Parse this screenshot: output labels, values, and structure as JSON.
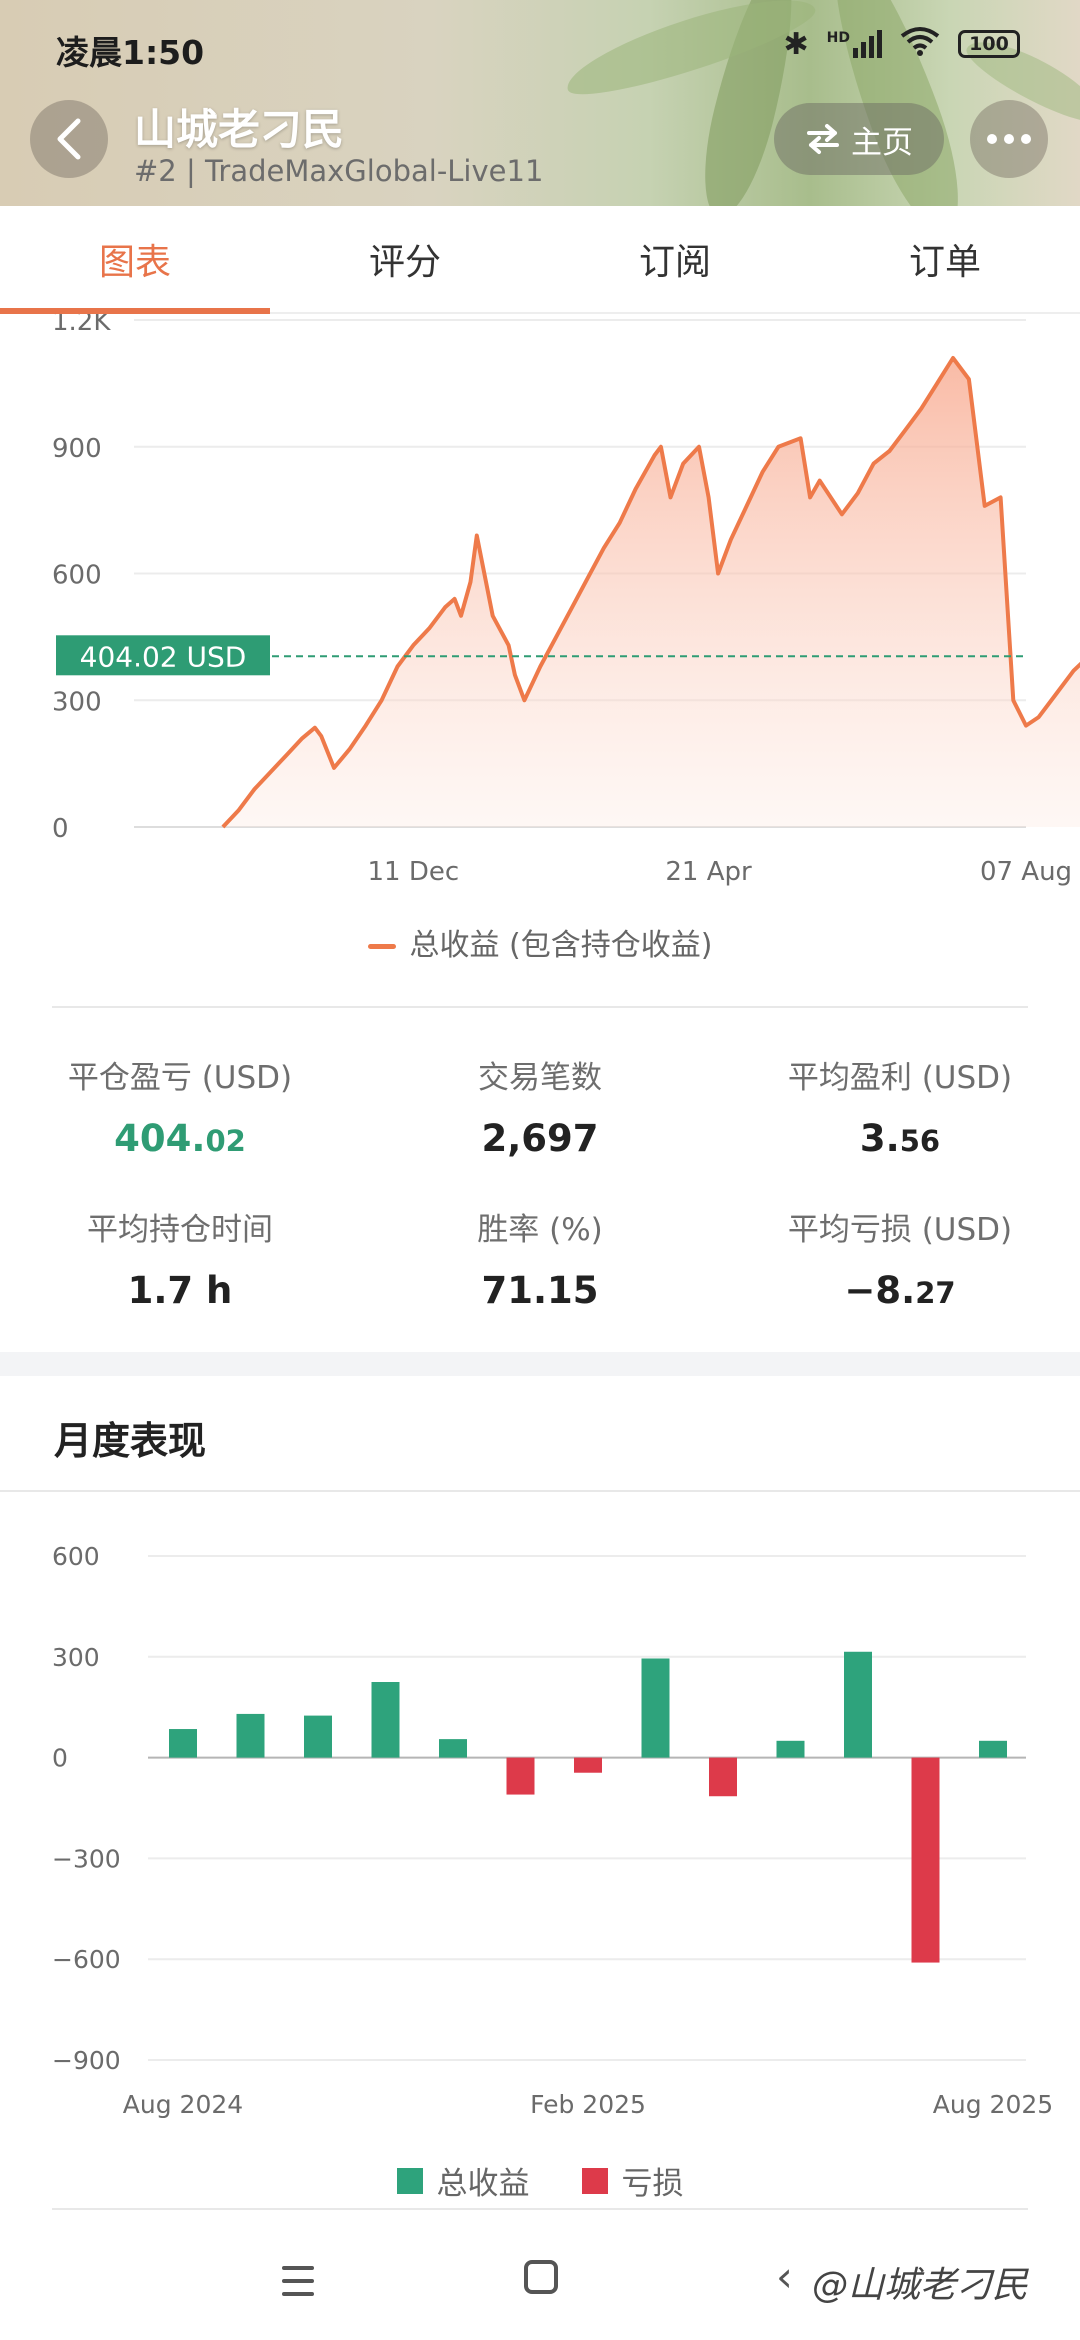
{
  "status_bar": {
    "time": "凌晨1:50",
    "signal": "HD",
    "battery": "100"
  },
  "header": {
    "title": "山城老刁民",
    "subtitle": "#2 | TradeMaxGlobal-Live11",
    "home_label": "主页"
  },
  "tabs": [
    {
      "label": "图表",
      "active": true
    },
    {
      "label": "评分",
      "active": false
    },
    {
      "label": "订阅",
      "active": false
    },
    {
      "label": "订单",
      "active": false
    }
  ],
  "line_chart": {
    "current_value_label": "404.02 USD",
    "legend": "总收益 (包含持仓收益)"
  },
  "stats": {
    "closed_pnl": {
      "label": "平仓盈亏 (USD)",
      "int": "404.",
      "dec": "02"
    },
    "trades": {
      "label": "交易笔数",
      "value": "2,697"
    },
    "avg_profit": {
      "label": "平均盈利 (USD)",
      "int": "3.",
      "dec": "56"
    },
    "avg_hold": {
      "label": "平均持仓时间",
      "value": "1.7 h"
    },
    "win_rate": {
      "label": "胜率 (%)",
      "value": "71.15"
    },
    "avg_loss": {
      "label": "平均亏损 (USD)",
      "int": "−8.",
      "dec": "27"
    }
  },
  "monthly": {
    "title": "月度表现",
    "legend_profit": "总收益",
    "legend_loss": "亏损"
  },
  "watermark": "@山城老刁民",
  "chart_data": [
    {
      "type": "area",
      "title": "",
      "xlabel": "",
      "ylabel": "",
      "ylim": [
        0,
        1200
      ],
      "yticks": [
        "0",
        "300",
        "600",
        "900",
        "1.2K"
      ],
      "xticks": [
        {
          "label": "11 Dec",
          "x": 60
        },
        {
          "label": "21 Apr",
          "x": 153
        },
        {
          "label": "07 Aug",
          "x": 253
        }
      ],
      "x_range": [
        -28,
        253
      ],
      "reference_line": 404.02,
      "color": "#ee7a4a",
      "series": [
        {
          "name": "总收益 (包含持仓收益)",
          "x": [
            0,
            5,
            10,
            15,
            20,
            25,
            29,
            31,
            35,
            40,
            45,
            50,
            55,
            60,
            65,
            70,
            73,
            75,
            78,
            80,
            85,
            90,
            92,
            95,
            100,
            105,
            110,
            115,
            120,
            125,
            130,
            136,
            138,
            141,
            145,
            150,
            153,
            156,
            160,
            165,
            170,
            175,
            182,
            185,
            188,
            195,
            200,
            205,
            210,
            215,
            220,
            225,
            230,
            235,
            240,
            245,
            249,
            253,
            257,
            262,
            268,
            275,
            281
          ],
          "values": [
            0,
            40,
            90,
            130,
            170,
            210,
            235,
            215,
            140,
            185,
            240,
            300,
            380,
            430,
            470,
            520,
            540,
            500,
            580,
            690,
            500,
            430,
            360,
            300,
            380,
            450,
            520,
            590,
            660,
            720,
            800,
            880,
            900,
            780,
            860,
            900,
            780,
            600,
            680,
            760,
            840,
            900,
            920,
            780,
            820,
            740,
            790,
            860,
            890,
            940,
            990,
            1050,
            1110,
            1060,
            760,
            780,
            300,
            240,
            260,
            310,
            370,
            420,
            450
          ]
        }
      ]
    },
    {
      "type": "bar",
      "title": "",
      "ylim": [
        -900,
        600
      ],
      "yticks": [
        "600",
        "300",
        "0",
        "−300",
        "−600",
        "−900"
      ],
      "xticks": [
        {
          "label": "Aug 2024",
          "index": 0
        },
        {
          "label": "Feb 2025",
          "index": 6
        },
        {
          "label": "Aug 2025",
          "index": 12
        }
      ],
      "categories": [
        "2024-08",
        "2024-09",
        "2024-10",
        "2024-11",
        "2024-12",
        "2025-01",
        "2025-02",
        "2025-03",
        "2025-04",
        "2025-05",
        "2025-06",
        "2025-07",
        "2025-08"
      ],
      "values": [
        85,
        130,
        125,
        225,
        55,
        -110,
        -45,
        295,
        -115,
        50,
        315,
        -610,
        50
      ],
      "colors": {
        "profit": "#2ea37c",
        "loss": "#dd3a4a"
      }
    }
  ]
}
